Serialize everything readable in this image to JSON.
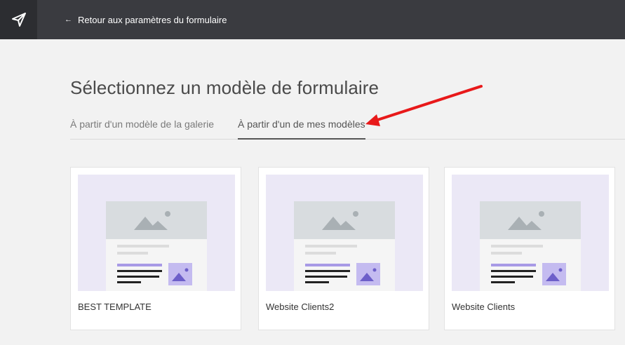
{
  "header": {
    "back_label": "Retour aux paramètres du formulaire",
    "back_icon": "arrow-left-icon",
    "logo_icon": "paper-plane-icon"
  },
  "page": {
    "title": "Sélectionnez un modèle de formulaire"
  },
  "tabs": [
    {
      "label": "À partir d'un modèle de la galerie",
      "active": false
    },
    {
      "label": "À partir d'un de mes modèles",
      "active": true
    }
  ],
  "templates": [
    {
      "name": "BEST TEMPLATE"
    },
    {
      "name": "Website Clients2"
    },
    {
      "name": "Website Clients"
    }
  ],
  "colors": {
    "topbar": "#3a3b40",
    "accent_purple": "#a89ae6",
    "annotation_arrow": "#e8191a"
  }
}
